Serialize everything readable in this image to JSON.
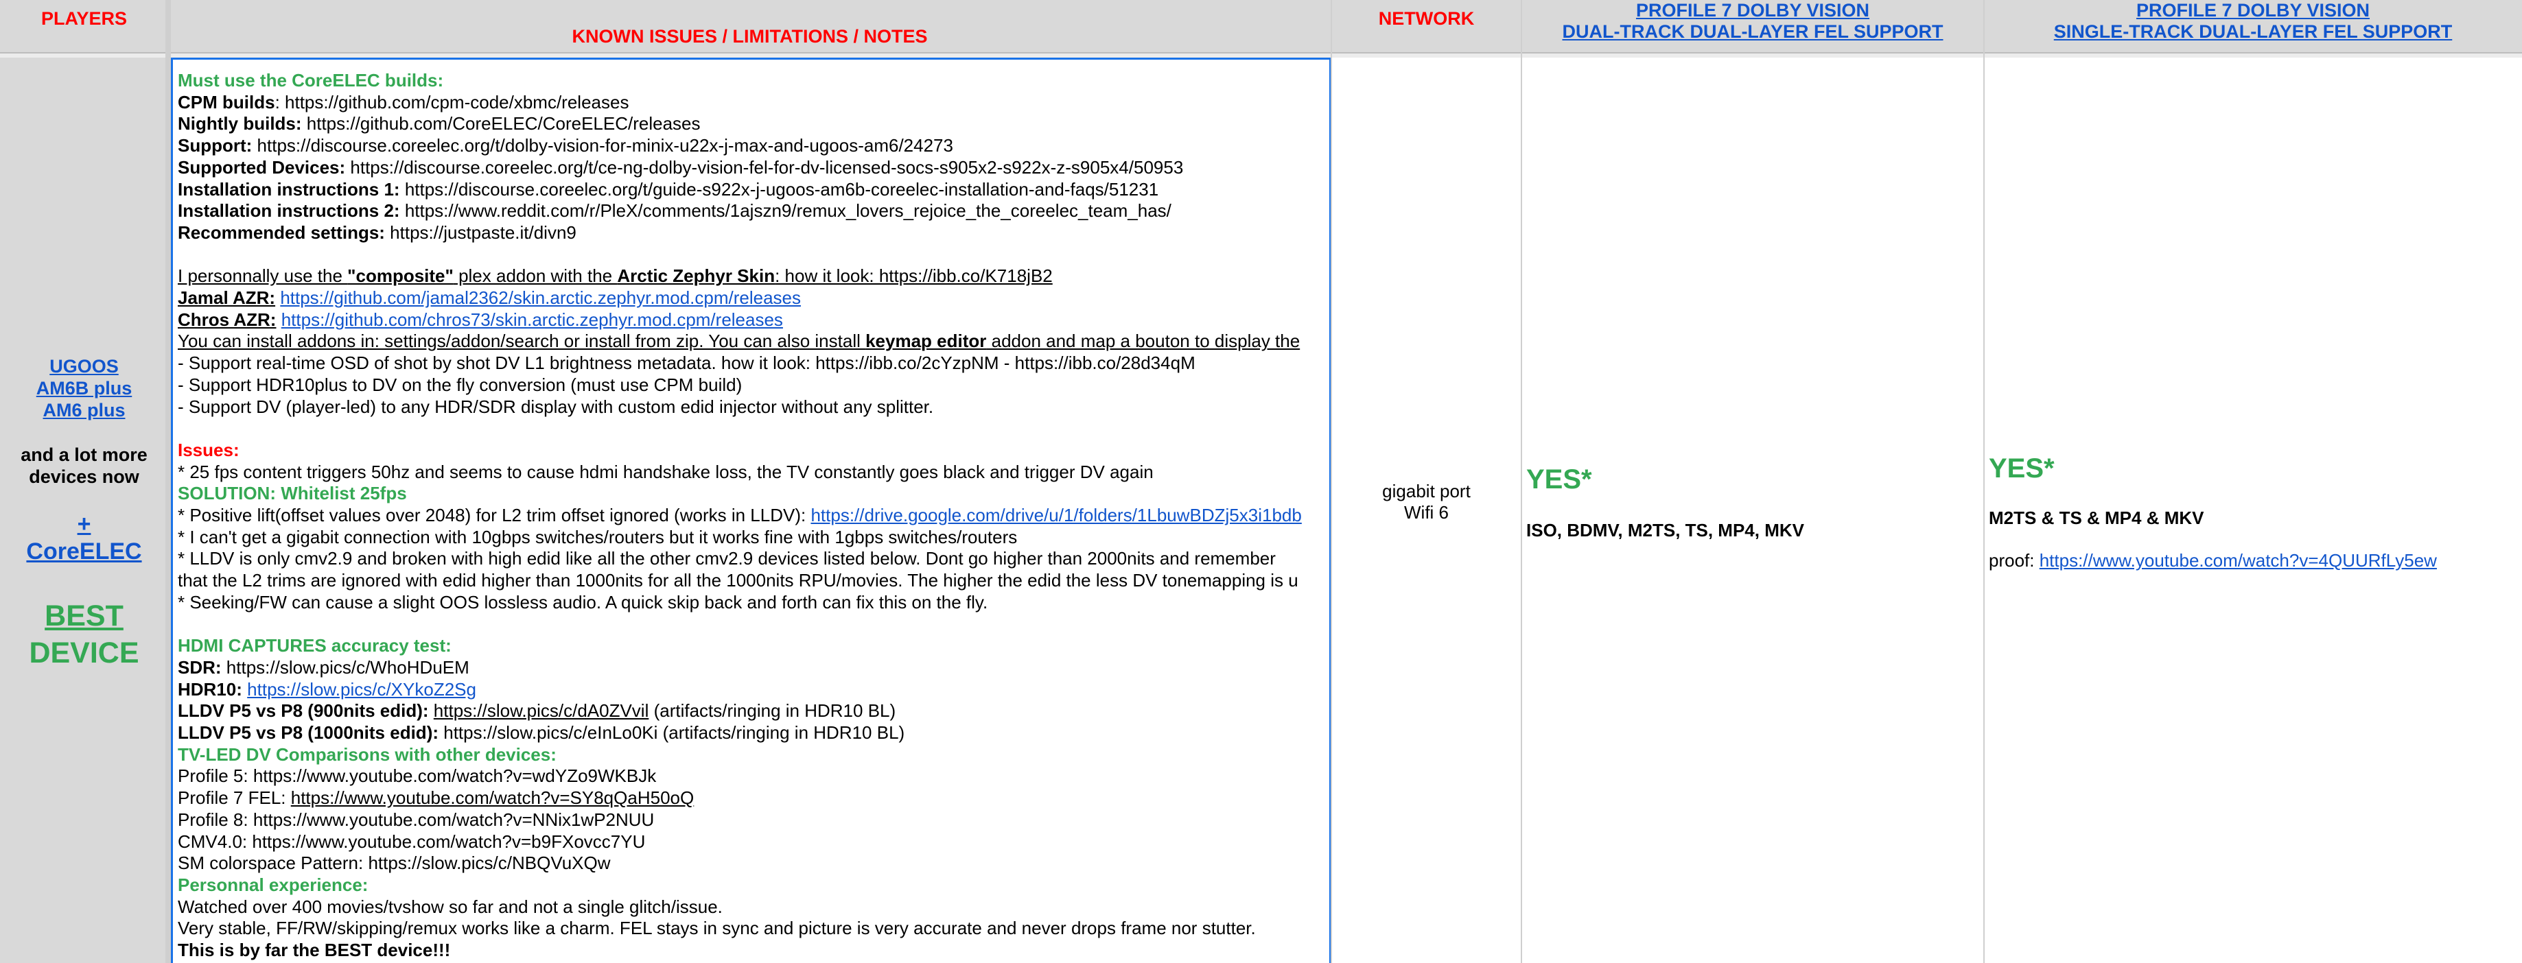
{
  "headers": {
    "players": "PLAYERS",
    "issues": "KNOWN ISSUES / LIMITATIONS / NOTES",
    "network": "NETWORK",
    "dual_l1": "PROFILE 7 DOLBY VISION",
    "dual_l2": "DUAL-TRACK DUAL-LAYER FEL SUPPORT",
    "single_l1": "PROFILE 7 DOLBY VISION",
    "single_l2": "SINGLE-TRACK DUAL-LAYER FEL SUPPORT"
  },
  "players": {
    "link1": "UGOOS",
    "link2": "AM6B plus",
    "link3": "AM6 plus",
    "more1": "and a lot more",
    "more2": "devices now",
    "plus": "+",
    "coreelec": "CoreELEC",
    "best1": "BEST",
    "best2": "DEVICE"
  },
  "issues": {
    "must": "Must use the CoreELEC builds:",
    "cpm_l": "CPM builds",
    "cpm_v": ": https://github.com/cpm-code/xbmc/releases",
    "nightly_l": "Nightly builds:",
    "nightly_v": " https://github.com/CoreELEC/CoreELEC/releases",
    "support_l": "Support:",
    "support_v": " https://discourse.coreelec.org/t/dolby-vision-for-minix-u22x-j-max-and-ugoos-am6/24273",
    "devices_l": "Supported Devices:",
    "devices_v": " https://discourse.coreelec.org/t/ce-ng-dolby-vision-fel-for-dv-licensed-socs-s905x2-s922x-z-s905x4/50953",
    "inst1_l": "Installation instructions 1:",
    "inst1_v": " https://discourse.coreelec.org/t/guide-s922x-j-ugoos-am6b-coreelec-installation-and-faqs/51231",
    "inst2_l": "Installation instructions 2:",
    "inst2_v": " https://www.reddit.com/r/PleX/comments/1ajszn9/remux_lovers_rejoice_the_coreelec_team_has/",
    "rec_l": "Recommended settings:",
    "rec_v": " https://justpaste.it/divn9",
    "use1": "I personnally use the ",
    "use2": "\"composite\"",
    "use3": " plex addon with the ",
    "use4": "Arctic Zephyr Skin",
    "use5": ": how it look:   https://ibb.co/K718jB2",
    "jamal_l": "Jamal AZR:",
    "jamal_v": "https://github.com/jamal2362/skin.arctic.zephyr.mod.cpm/releases",
    "chros_l": "Chros AZR:",
    "chros_v": "https://github.com/chros73/skin.arctic.zephyr.mod.cpm/releases",
    "addon1": "You can install addons in: settings/addon/search or install from zip. You can also install ",
    "addon2": "keymap editor",
    "addon3": " addon and map a bouton to display the",
    "osd": "- Support real-time OSD of shot by shot DV L1 brightness metadata. how it look:    https://ibb.co/2cYzpNM        -     https://ibb.co/28d34qM",
    "hdr10": "- Support HDR10plus to DV on the fly conversion (must use CPM build)",
    "player_led": "- Support DV (player-led) to any HDR/SDR display with custom edid injector without any splitter.",
    "issues_h": "Issues:",
    "fps25": "* 25 fps content triggers 50hz and seems to cause hdmi handshake loss, the TV constantly goes black and trigger DV again",
    "solution": "SOLUTION: Whitelist 25fps",
    "lift1": "* Positive lift(offset values over 2048) for L2 trim offset ignored (works in LLDV): ",
    "lift2": "https://drive.google.com/drive/u/1/folders/1LbuwBDZj5x3i1bdb",
    "gigabit": "* I can't get a gigabit connection with 10gbps switches/routers but it works fine with 1gbps switches/routers",
    "lldv1": "* LLDV is only cmv2.9 and broken with high edid like all the other cmv2.9 devices listed below. Dont go higher than 2000nits and remember",
    "lldv2": "that the L2 trims are ignored with edid higher than 1000nits for all the 1000nits RPU/movies. The higher the edid the less DV tonemapping is u",
    "seek": "* Seeking/FW can cause a slight OOS lossless audio. A quick skip back and forth can fix this on the fly.",
    "hdmi_h": "HDMI CAPTURES accuracy test:",
    "sdr_l": "SDR:",
    "sdr_v": " https://slow.pics/c/WhoHDuEM",
    "hdr10_l": "HDR10:",
    "hdr10_v": "https://slow.pics/c/XYkoZ2Sg",
    "p5p8a_l": "LLDV P5 vs P8 (900nits edid):",
    "p5p8a_v": "https://slow.pics/c/dA0ZVvil",
    "p5p8a_n": "  (artifacts/ringing in HDR10 BL)",
    "p5p8b_l": "LLDV P5 vs P8 (1000nits edid):",
    "p5p8b_v": " https://slow.pics/c/eInLo0Ki  (artifacts/ringing in HDR10 BL)",
    "tvled_h": "TV-LED DV Comparisons with other devices:",
    "prof5": "Profile 5: https://www.youtube.com/watch?v=wdYZo9WKBJk",
    "prof7_l": "Profile 7 FEL: ",
    "prof7_v": "https://www.youtube.com/watch?v=SY8qQaH50oQ",
    "prof8": "Profile 8: https://www.youtube.com/watch?v=NNix1wP2NUU",
    "cmv4": "CMV4.0: https://www.youtube.com/watch?v=b9FXovcc7YU",
    "sm": "SM colorspace Pattern: https://slow.pics/c/NBQVuXQw",
    "pers_h": "Personnal experience:",
    "watched": "Watched over 400 movies/tvshow so far and not a single glitch/issue.",
    "stable": "Very stable, FF/RW/skipping/remux works like a charm. FEL stays in sync and picture is very accurate and never drops frame nor stutter.",
    "best": "This is by far the BEST device!!!"
  },
  "network": {
    "line1": "gigabit port",
    "line2": "Wifi 6"
  },
  "dual": {
    "yes": "YES*",
    "formats": "ISO, BDMV, M2TS, TS, MP4, MKV"
  },
  "single": {
    "yes": "YES*",
    "formats": "M2TS & TS & MP4 & MKV",
    "proof_l": "proof: ",
    "proof_v": "https://www.youtube.com/watch?v=4QUURfLy5ew"
  },
  "colors": {
    "red": "#ff0000",
    "green": "#34a853",
    "link_blue": "#1155cc",
    "header_gray": "#d9d9d9",
    "selection_blue": "#1a73e8"
  }
}
